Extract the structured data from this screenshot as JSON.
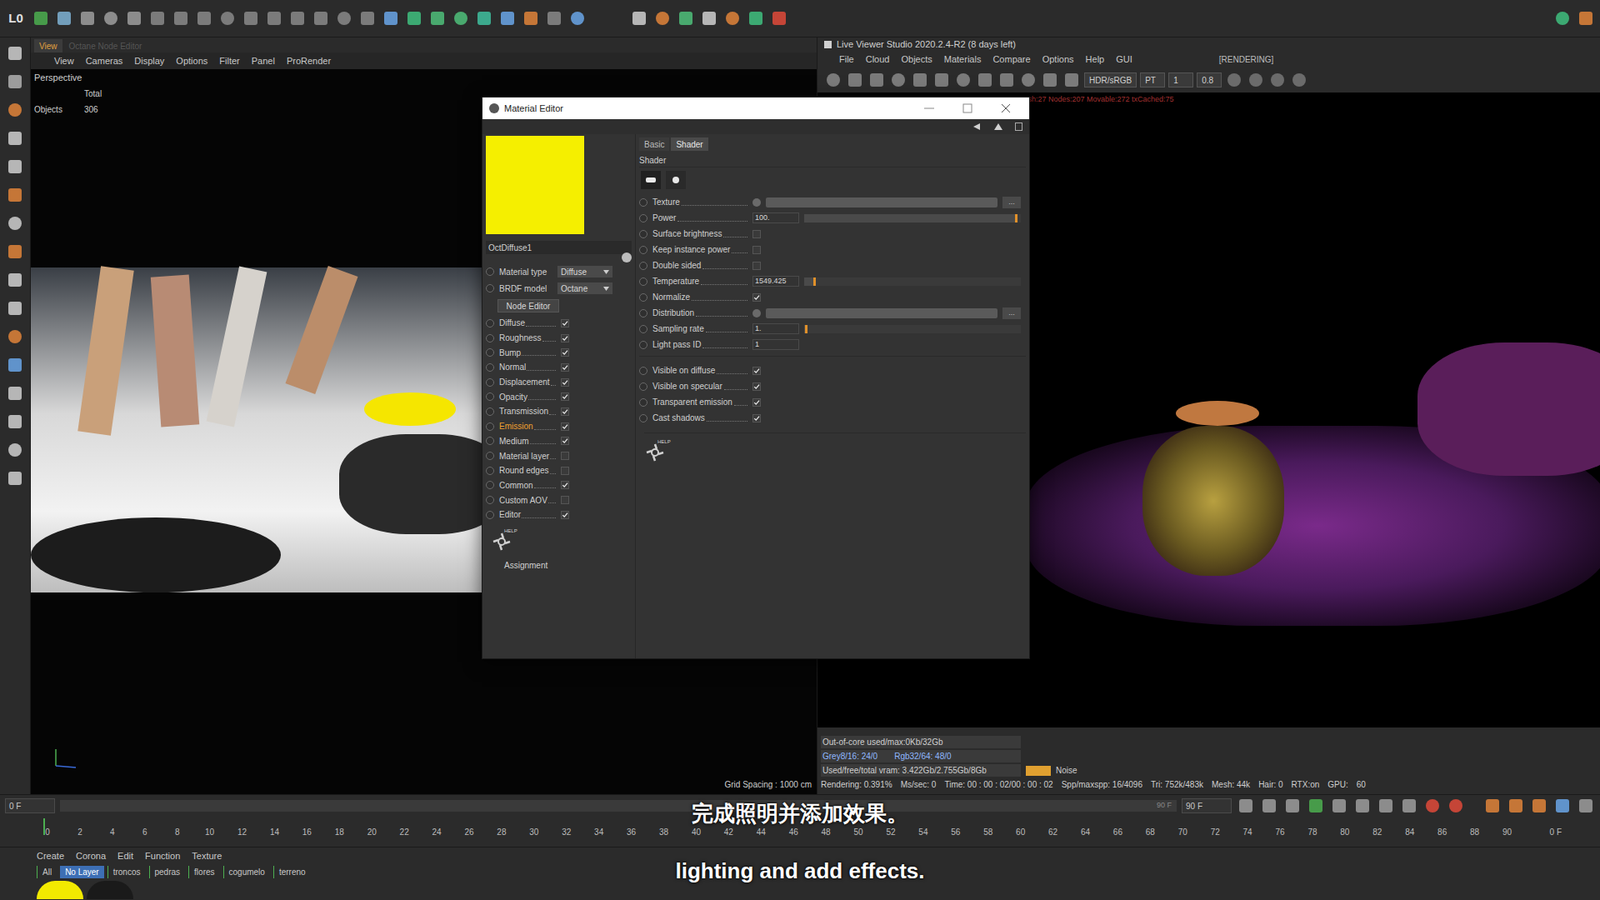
{
  "top_toolbar": {
    "badge": "L0"
  },
  "viewport": {
    "tabs": [
      {
        "label": "View",
        "selected": true
      },
      {
        "label": "Octane Node Editor",
        "selected": false
      }
    ],
    "menu": [
      "View",
      "Cameras",
      "Display",
      "Options",
      "Filter",
      "Panel",
      "ProRender"
    ],
    "camera": "Perspective",
    "stats_header": "Total",
    "stats": [
      {
        "label": "Objects",
        "value": "306"
      }
    ],
    "grid": "Grid Spacing : 1000 cm"
  },
  "live_viewer": {
    "title": "Live Viewer Studio 2020.2.4-R2 (8 days left)",
    "menu": [
      "File",
      "Cloud",
      "Objects",
      "Materials",
      "Compare",
      "Options",
      "Help",
      "GUI"
    ],
    "status": "[RENDERING]",
    "fields": [
      "HDR/sRGB",
      "PT",
      "1",
      "0.8"
    ],
    "overlay_info": "Mesh:27 Nodes:207 Movable:272 txCached:75",
    "stats": {
      "memory": "Out-of-core used/max:0Kb/32Gb",
      "textures": [
        "Grey8/16: 24/0",
        "Rgb32/64: 48/0"
      ],
      "vram": "Used/free/total vram: 3.422Gb/2.755Gb/8Gb",
      "noise": "Noise",
      "status_bar": [
        "Rendering: 0.391%",
        "Ms/sec: 0",
        "Time: 00 : 00 : 02/00 : 00 : 02",
        "Spp/maxspp: 16/4096",
        "Tri: 752k/483k",
        "Mesh: 44k",
        "Hair: 0",
        "RTX:on",
        "GPU:",
        "60"
      ]
    }
  },
  "material_editor": {
    "title": "Material Editor",
    "name": "OctDiffuse1",
    "dropdowns": [
      {
        "label": "Material type",
        "value": "Diffuse"
      },
      {
        "label": "BRDF model",
        "value": "Octane"
      }
    ],
    "node_editor_button": "Node Editor",
    "channels": [
      {
        "label": "Diffuse",
        "checked": true,
        "selected": false
      },
      {
        "label": "Roughness",
        "checked": true,
        "selected": false
      },
      {
        "label": "Bump",
        "checked": true,
        "selected": false
      },
      {
        "label": "Normal",
        "checked": true,
        "selected": false
      },
      {
        "label": "Displacement",
        "checked": true,
        "selected": false
      },
      {
        "label": "Opacity",
        "checked": true,
        "selected": false
      },
      {
        "label": "Transmission",
        "checked": true,
        "selected": false
      },
      {
        "label": "Emission",
        "checked": true,
        "selected": true
      },
      {
        "label": "Medium",
        "checked": true,
        "selected": false
      },
      {
        "label": "Material layer",
        "checked": false,
        "selected": false
      },
      {
        "label": "Round edges",
        "checked": false,
        "selected": false
      },
      {
        "label": "Common",
        "checked": true,
        "selected": false
      },
      {
        "label": "Custom AOV",
        "checked": false,
        "selected": false
      },
      {
        "label": "Editor",
        "checked": true,
        "selected": false
      }
    ],
    "help_label": "HELP",
    "assignment": "Assignment",
    "tabs": [
      {
        "label": "Basic",
        "selected": false
      },
      {
        "label": "Shader",
        "selected": true
      }
    ],
    "section": "Shader",
    "params": [
      {
        "kind": "texture",
        "label": "Texture",
        "more": "..."
      },
      {
        "kind": "slider",
        "label": "Power",
        "value": "100.",
        "level": 0.98
      },
      {
        "kind": "checkbox",
        "label": "Surface brightness",
        "checked": false
      },
      {
        "kind": "checkbox",
        "label": "Keep instance power",
        "checked": false
      },
      {
        "kind": "checkbox",
        "label": "Double sided",
        "checked": false
      },
      {
        "kind": "slider",
        "label": "Temperature",
        "value": "1549.425",
        "level": 0.05
      },
      {
        "kind": "checkbox",
        "label": "Normalize",
        "checked": true
      },
      {
        "kind": "texture",
        "label": "Distribution",
        "more": "..."
      },
      {
        "kind": "slider",
        "label": "Sampling rate",
        "value": "1.",
        "level": 0.01
      },
      {
        "kind": "number",
        "label": "Light pass ID",
        "value": "1"
      },
      {
        "kind": "checkbox",
        "label": "Visible on diffuse",
        "checked": true
      },
      {
        "kind": "checkbox",
        "label": "Visible on specular",
        "checked": true
      },
      {
        "kind": "checkbox",
        "label": "Transparent emission",
        "checked": true
      },
      {
        "kind": "checkbox",
        "label": "Cast shadows",
        "checked": true
      }
    ]
  },
  "timeline": {
    "start": "0 F",
    "end": "90 F",
    "end_field": "90 F",
    "current": "0 F",
    "ticks": [
      "0",
      "2",
      "4",
      "6",
      "8",
      "10",
      "12",
      "14",
      "16",
      "18",
      "20",
      "22",
      "24",
      "26",
      "28",
      "30",
      "32",
      "34",
      "36",
      "38",
      "40",
      "42",
      "44",
      "46",
      "48",
      "50",
      "52",
      "54",
      "56",
      "58",
      "60",
      "62",
      "64",
      "66",
      "68",
      "70",
      "72",
      "74",
      "76",
      "78",
      "80",
      "82",
      "84",
      "86",
      "88",
      "90"
    ]
  },
  "material_manager": {
    "menu": [
      "Create",
      "Corona",
      "Edit",
      "Function",
      "Texture"
    ],
    "layers": [
      {
        "label": "All",
        "selected": false
      },
      {
        "label": "No Layer",
        "selected": true
      },
      {
        "label": "troncos",
        "selected": false
      },
      {
        "label": "pedras",
        "selected": false
      },
      {
        "label": "flores",
        "selected": false
      },
      {
        "label": "cogumelo",
        "selected": false
      },
      {
        "label": "terreno",
        "selected": false
      }
    ],
    "materials": [
      {
        "color": "#f2ea00"
      },
      {
        "color": "#1a1a1a"
      }
    ]
  },
  "subtitles": [
    "完成照明并添加效果。",
    "lighting and add effects."
  ]
}
